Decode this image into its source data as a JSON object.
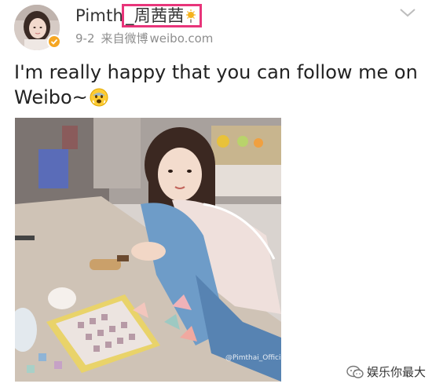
{
  "post": {
    "username_prefix": "Pimth",
    "username_highlight": "_周茜茜",
    "date": "9-2",
    "source_label": "来自微博",
    "source_domain": "weibo.com",
    "text": "I'm really happy that you can follow me on Weibo~",
    "emoji": "fearful-face-emoji",
    "photo_watermark": "@Pimthai_Official"
  },
  "footer": {
    "watermark": "娱乐你最大"
  },
  "colors": {
    "highlight_border": "#e8357a",
    "verified_badge": "#f5a623",
    "meta_text": "#8e8e8e"
  },
  "icons": {
    "verified": "verified-badge-icon",
    "sun": "sun-icon",
    "chevron": "chevron-down-icon",
    "wechat": "wechat-icon"
  }
}
